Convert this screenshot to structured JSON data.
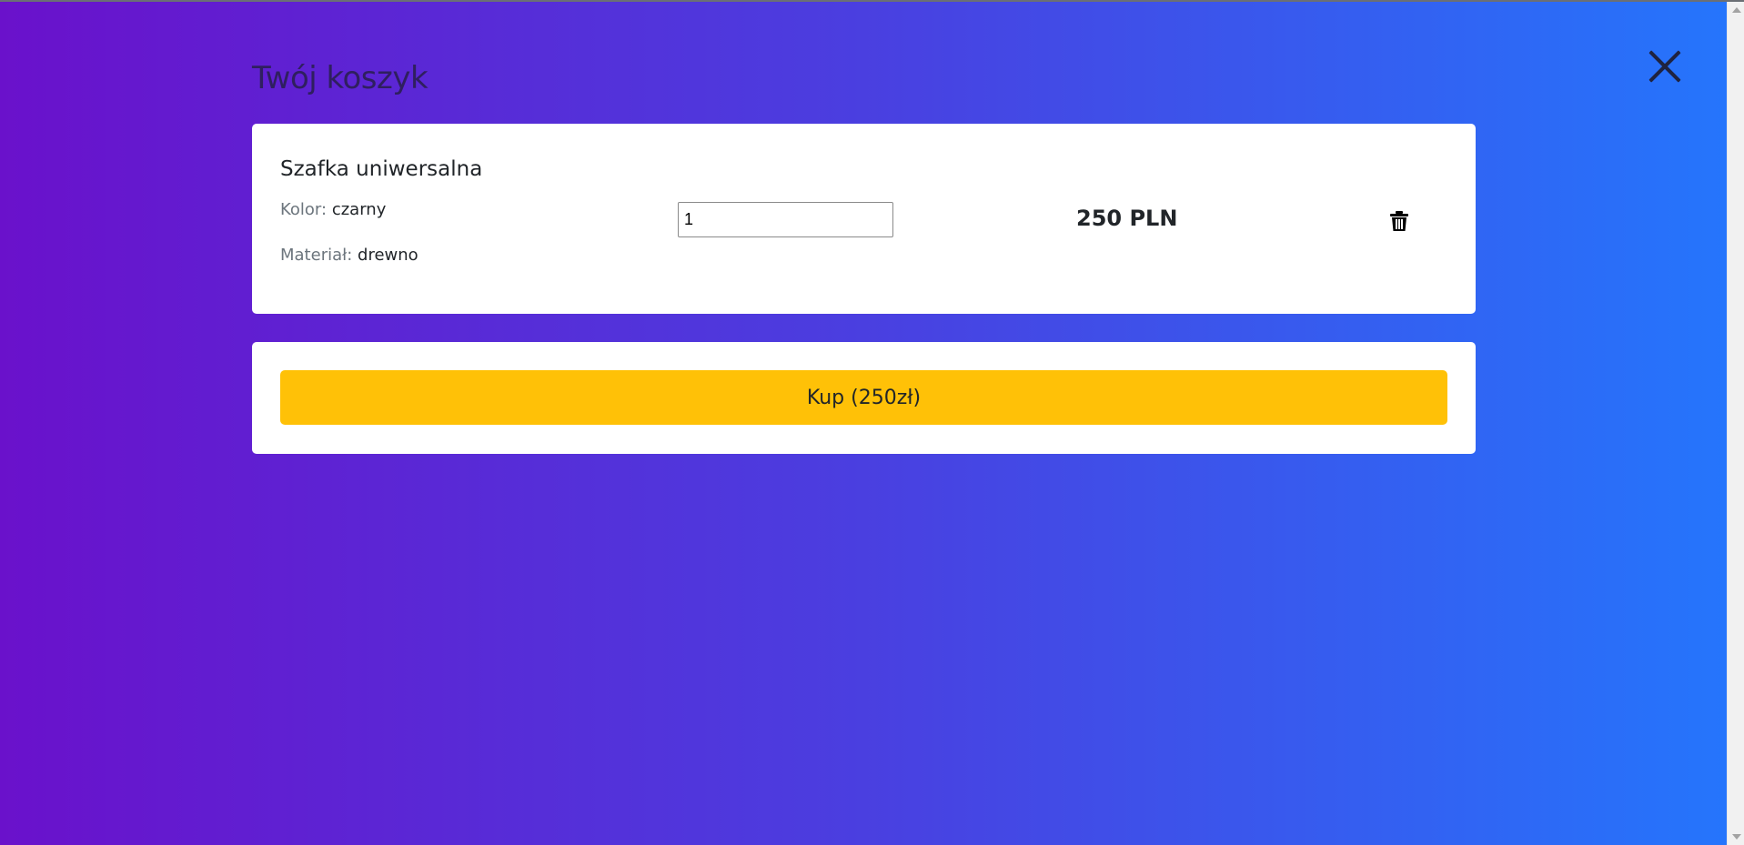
{
  "page": {
    "title": "Twój koszyk",
    "close_icon": "close-icon"
  },
  "cart": {
    "items": [
      {
        "name": "Szafka uniwersalna",
        "color_label": "Kolor:",
        "color_value": "czarny",
        "material_label": "Materiał:",
        "material_value": "drewno",
        "quantity": "1",
        "price": "250 PLN",
        "remove_icon": "trash-icon"
      }
    ]
  },
  "checkout": {
    "buy_label": "Kup (250zł)"
  },
  "colors": {
    "gradient_start": "#6a11cb",
    "gradient_end": "#2575fc",
    "buy_button": "#ffc107",
    "card": "#ffffff"
  }
}
